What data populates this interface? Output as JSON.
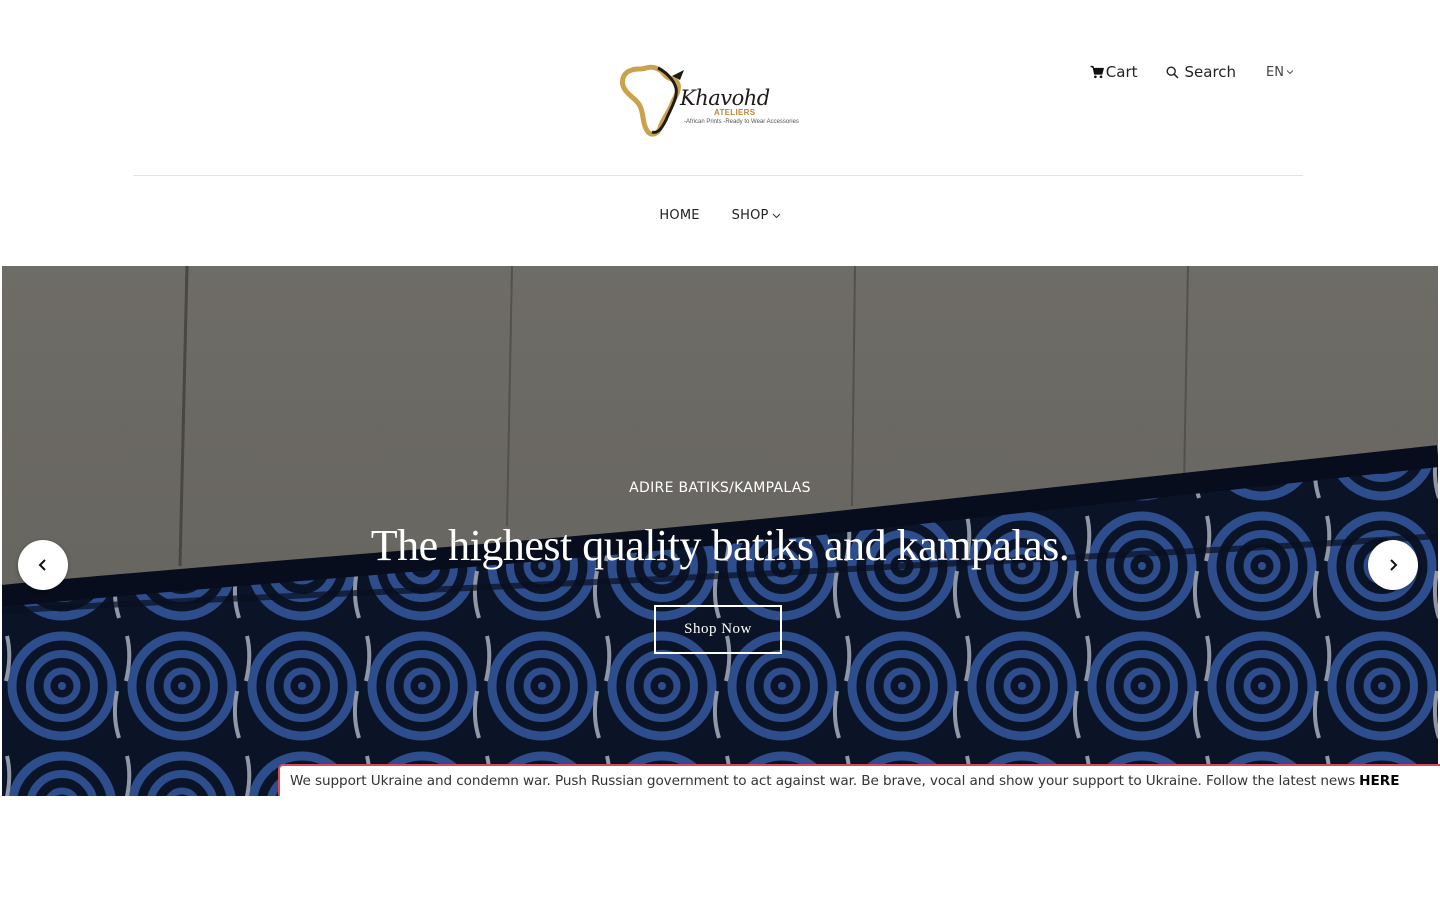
{
  "header": {
    "logo": {
      "name": "Khavohd",
      "sub": "ATELIERS",
      "tagline": "-African Prints -Ready to Wear Accessories"
    },
    "cart_label": "Cart",
    "search_label": "Search",
    "language": "EN"
  },
  "nav": {
    "items": [
      {
        "label": "HOME"
      },
      {
        "label": "SHOP"
      }
    ]
  },
  "hero": {
    "kicker": "ADIRE BATIKS/KAMPALAS",
    "title": "The highest quality batiks and kampalas.",
    "button_label": "Shop Now"
  },
  "banner": {
    "text": "We support Ukraine and condemn war. Push Russian government to act against war. Be brave, vocal and show your support to Ukraine. Follow the latest news",
    "link_label": "HERE",
    "border_color": "#d9485a"
  },
  "icons": {
    "cart": "cart-icon",
    "search": "search-icon",
    "language_dropdown": "chevron-down-icon",
    "shop_dropdown": "chevron-down-icon",
    "prev": "chevron-left-icon",
    "next": "chevron-right-icon"
  }
}
